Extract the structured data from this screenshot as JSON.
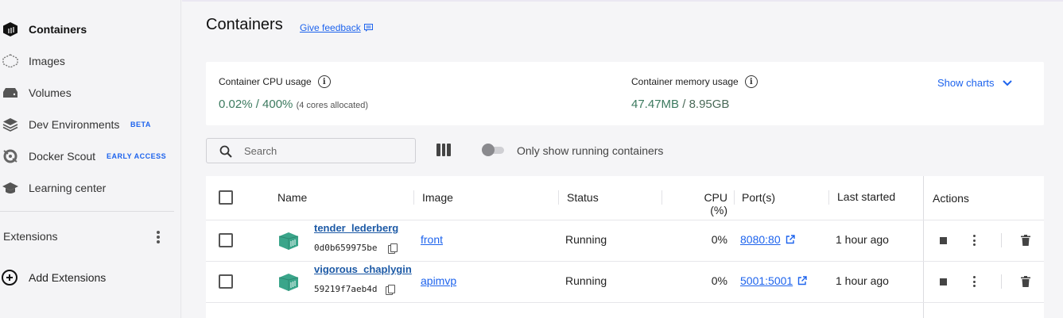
{
  "sidebar": {
    "items": [
      {
        "label": "Containers",
        "icon": "containers-icon",
        "active": true
      },
      {
        "label": "Images",
        "icon": "images-icon"
      },
      {
        "label": "Volumes",
        "icon": "volumes-icon"
      },
      {
        "label": "Dev Environments",
        "icon": "dev-environments-icon",
        "badge": "BETA"
      },
      {
        "label": "Docker Scout",
        "icon": "docker-scout-icon",
        "badge": "EARLY ACCESS"
      },
      {
        "label": "Learning center",
        "icon": "learning-center-icon"
      }
    ],
    "extensions_label": "Extensions",
    "add_extensions_label": "Add Extensions"
  },
  "header": {
    "title": "Containers",
    "feedback_label": "Give feedback"
  },
  "usage": {
    "cpu_title": "Container CPU usage",
    "cpu_value": "0.02% / 400%",
    "cpu_note": "(4 cores allocated)",
    "memory_title": "Container memory usage",
    "memory_used": "47.47MB",
    "memory_sep": " / ",
    "memory_total": "8.95GB",
    "show_charts_label": "Show charts"
  },
  "toolbar": {
    "search_placeholder": "Search",
    "toggle_label": "Only show running containers",
    "toggle_on": false
  },
  "table": {
    "columns": {
      "name": "Name",
      "image": "Image",
      "status": "Status",
      "cpu": "CPU (%)",
      "ports": "Port(s)",
      "last_started": "Last started",
      "actions": "Actions"
    },
    "rows": [
      {
        "name": "tender_lederberg",
        "id": "0d0b659975be",
        "image": "front",
        "status": "Running",
        "cpu": "0%",
        "port": "8080:80",
        "last_started": "1 hour ago"
      },
      {
        "name": "vigorous_chaplygin",
        "id": "59219f7aeb4d",
        "image": "apimvp",
        "status": "Running",
        "cpu": "0%",
        "port": "5001:5001",
        "last_started": "1 hour ago"
      }
    ]
  },
  "colors": {
    "accent": "#1d63ed",
    "usage_green": "#3c7a5f",
    "container_icon": "#3aa58a"
  }
}
